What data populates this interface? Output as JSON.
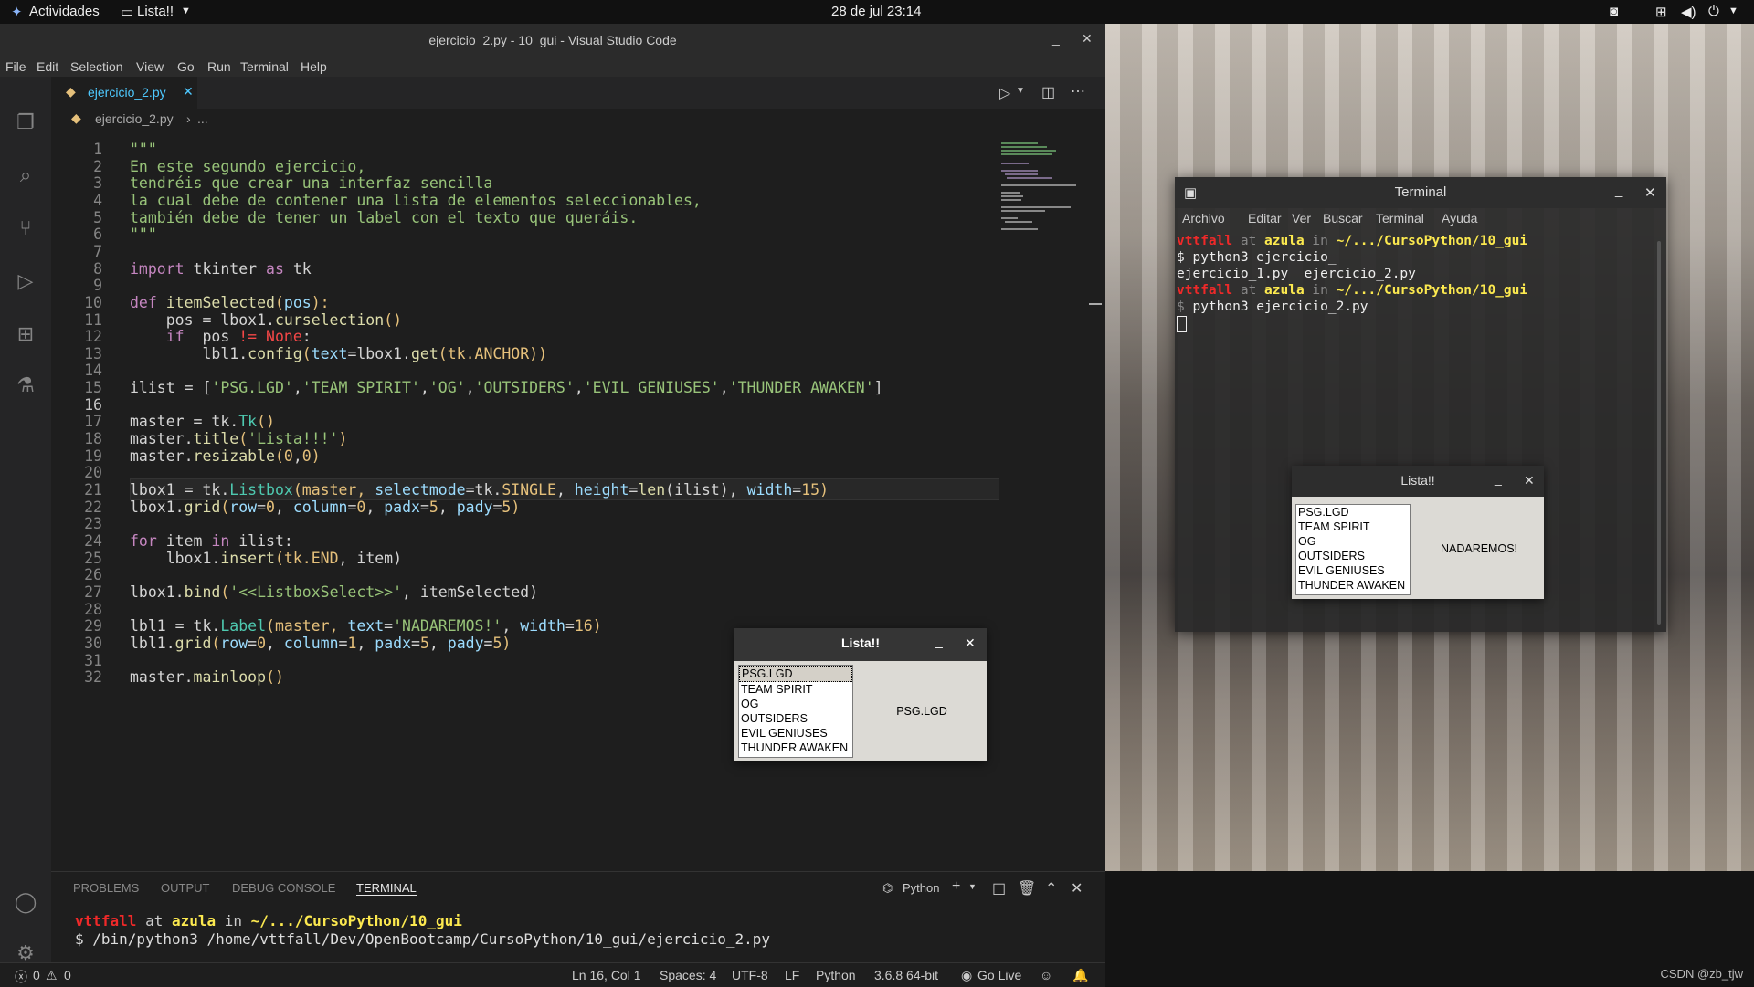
{
  "topbar": {
    "activities": "Actividades",
    "app_name": "Lista!!",
    "datetime": "28 de jul  23:14"
  },
  "vscode": {
    "title": "ejercicio_2.py - 10_gui - Visual Studio Code",
    "menu": [
      "File",
      "Edit",
      "Selection",
      "View",
      "Go",
      "Run",
      "Terminal",
      "Help"
    ],
    "tab_label": "ejercicio_2.py",
    "breadcrumb": "ejercicio_2.py",
    "breadcrumb_more": "...",
    "code_lines": [
      {
        "n": "1"
      },
      {
        "n": "2"
      },
      {
        "n": "3"
      },
      {
        "n": "4"
      },
      {
        "n": "5"
      },
      {
        "n": "6"
      },
      {
        "n": "7"
      },
      {
        "n": "8"
      },
      {
        "n": "9"
      },
      {
        "n": "10"
      },
      {
        "n": "11"
      },
      {
        "n": "12"
      },
      {
        "n": "13"
      },
      {
        "n": "14"
      },
      {
        "n": "15"
      },
      {
        "n": "16"
      },
      {
        "n": "17"
      },
      {
        "n": "18"
      },
      {
        "n": "19"
      },
      {
        "n": "20"
      },
      {
        "n": "21"
      },
      {
        "n": "22"
      },
      {
        "n": "23"
      },
      {
        "n": "24"
      },
      {
        "n": "25"
      },
      {
        "n": "26"
      },
      {
        "n": "27"
      },
      {
        "n": "28"
      },
      {
        "n": "29"
      },
      {
        "n": "30"
      },
      {
        "n": "31"
      },
      {
        "n": "32"
      }
    ],
    "code": {
      "l1": "\"\"\"",
      "l2": "En este segundo ejercicio,",
      "l3": "tendréis que crear una interfaz sencilla",
      "l4": "la cual debe de contener una lista de elementos seleccionables,",
      "l5": "también debe de tener un label con el texto que queráis.",
      "l6": "\"\"\"",
      "l8a": "import",
      "l8b": " tkinter ",
      "l8c": "as",
      "l8d": " tk",
      "l10a": "def ",
      "l10b": "itemSelected",
      "l10c": "(",
      "l10d": "pos",
      "l10e": "):",
      "l11a": "    pos = lbox1.",
      "l11b": "curselection",
      "l11c": "()",
      "l12a": "    ",
      "l12b": "if",
      "l12c": "  pos ",
      "l12d": "!=",
      "l12e": " None",
      ":": ":",
      "l13a": "        lbl1.",
      "l13b": "config",
      "l13c": "(",
      "l13d": "text",
      "l13e": "=lbox1.",
      "l13f": "get",
      "l13g": "(tk.",
      "l13h": "ANCHOR",
      "l13i": "))",
      "l15a": "ilist = [",
      "l15b": "'PSG.LGD'",
      "l15c": ",",
      "l15d": "'TEAM SPIRIT'",
      "l15e": ",",
      "l15f": "'OG'",
      "l15g": ",",
      "l15h": "'OUTSIDERS'",
      "l15i": ",",
      "l15j": "'EVIL GENIUSES'",
      "l15k": ",",
      "l15l": "'THUNDER AWAKEN'",
      "l15m": "]",
      "l17a": "master = tk.",
      "l17b": "Tk",
      "l17c": "()",
      "l18a": "master.",
      "l18b": "title",
      "l18c": "(",
      "l18d": "'Lista!!!'",
      "l18e": ")",
      "l19a": "master.",
      "l19b": "resizable",
      "l19c": "(",
      "l19d": "0",
      "l19e": ",",
      "l19f": "0",
      "l19g": ")",
      "l21a": "lbox1 = tk.",
      "l21b": "Listbox",
      "l21c": "(master, ",
      "l21d": "selectmode",
      "l21e": "=tk.",
      "l21f": "SINGLE",
      ", ": ", ",
      "l21g": "height",
      "l21h": "=",
      "l21i": "len",
      "l21j": "(ilist), ",
      "l21k": "width",
      "l21l": "=",
      "l21m": "15",
      "l21n": ")",
      "l22a": "lbox1.",
      "l22b": "grid",
      "l22c": "(",
      "l22d": "row",
      "l22e": "=",
      "l22f": "0",
      "l22g": ", ",
      "l22h": "column",
      "l22i": "=",
      "l22j": "0",
      "l22k": ", ",
      "l22l": "padx",
      "l22m": "=",
      "l22n": "5",
      "l22o": ", ",
      "l22p": "pady",
      "l22q": "=",
      "l22r": "5",
      "l22s": ")",
      "l24a": "for ",
      "l24b": "item ",
      "l24c": "in",
      " ilist": " ilist:",
      "l25a": "    lbox1.",
      "l25b": "insert",
      "l25c": "(tk.",
      "l25d": "END",
      ", item)": ", item)",
      "l27a": "lbox1.",
      "l27b": "bind",
      "l27c": "(",
      "l27d": "'<<ListboxSelect>>'",
      ", itemSelected)": ", itemSelected)",
      "l29a": "lbl1 = tk.",
      "l29b": "Label",
      "l29c": "(master, ",
      "l29d": "text",
      "l29e": "=",
      "l29f": "'NADAREMOS!'",
      "l29g": "width",
      "l29h": "=",
      "l29i": "16",
      "l29j": ")",
      "l30a": "lbl1.",
      "l30b": "grid",
      "l30c": "(",
      "l30d": "row",
      "l30e": "=",
      "l30f": "0",
      "l30g": ", ",
      "l30h": "column",
      "l30i": "=",
      "l30j": "1",
      "l30k": ", ",
      "l30l": "padx",
      "l30m": "=",
      "l30n": "5",
      "l30o": ", ",
      "l30p": "pady",
      "l30q": "=",
      "l30r": "5",
      "l30s": ")",
      "l32a": "master.",
      "l32b": "mainloop",
      "l32c": "()"
    },
    "panel_tabs": [
      "PROBLEMS",
      "OUTPUT",
      "DEBUG CONSOLE",
      "TERMINAL"
    ],
    "panel_shell": "Python",
    "panel_prompt": {
      "user": "vttfall",
      "at": " at ",
      "host": "azula",
      "in": " in ",
      "path": "~/.../CursoPython/10_gui"
    },
    "panel_cmd": "$ /bin/python3 /home/vttfall/Dev/OpenBootcamp/CursoPython/10_gui/ejercicio_2.py",
    "status": {
      "errors": "0",
      "warnings": "0",
      "position": "Ln 16, Col 1",
      "spaces": "Spaces: 4",
      "encoding": "UTF-8",
      "eol": "LF",
      "language": "Python",
      "interpreter": "3.6.8 64-bit",
      "golive": "Go Live"
    }
  },
  "tk_front": {
    "title": "Lista!!",
    "items": [
      "PSG.LGD",
      "TEAM SPIRIT",
      "OG",
      "OUTSIDERS",
      "EVIL GENIUSES",
      "THUNDER AWAKEN"
    ],
    "label": "PSG.LGD"
  },
  "tk_back": {
    "title": "Lista!!",
    "items": [
      "PSG.LGD",
      "TEAM SPIRIT",
      "OG",
      "OUTSIDERS",
      "EVIL GENIUSES",
      "THUNDER AWAKEN"
    ],
    "label": "NADAREMOS!"
  },
  "terminal": {
    "title": "Terminal",
    "menu": [
      "Archivo",
      "Editar",
      "Ver",
      "Buscar",
      "Terminal",
      "Ayuda"
    ],
    "user": "vttfall",
    "at": " at ",
    "host": "azula",
    "in": " in ",
    "path": "~/.../CursoPython/10_gui",
    "cmd1": "$ python3 ejercicio_",
    "completions": "ejercicio_1.py  ejercicio_2.py",
    "cmd2": " python3 ejercicio_2.py",
    "dollar": "$"
  },
  "watermark": "CSDN @zb_tjw"
}
